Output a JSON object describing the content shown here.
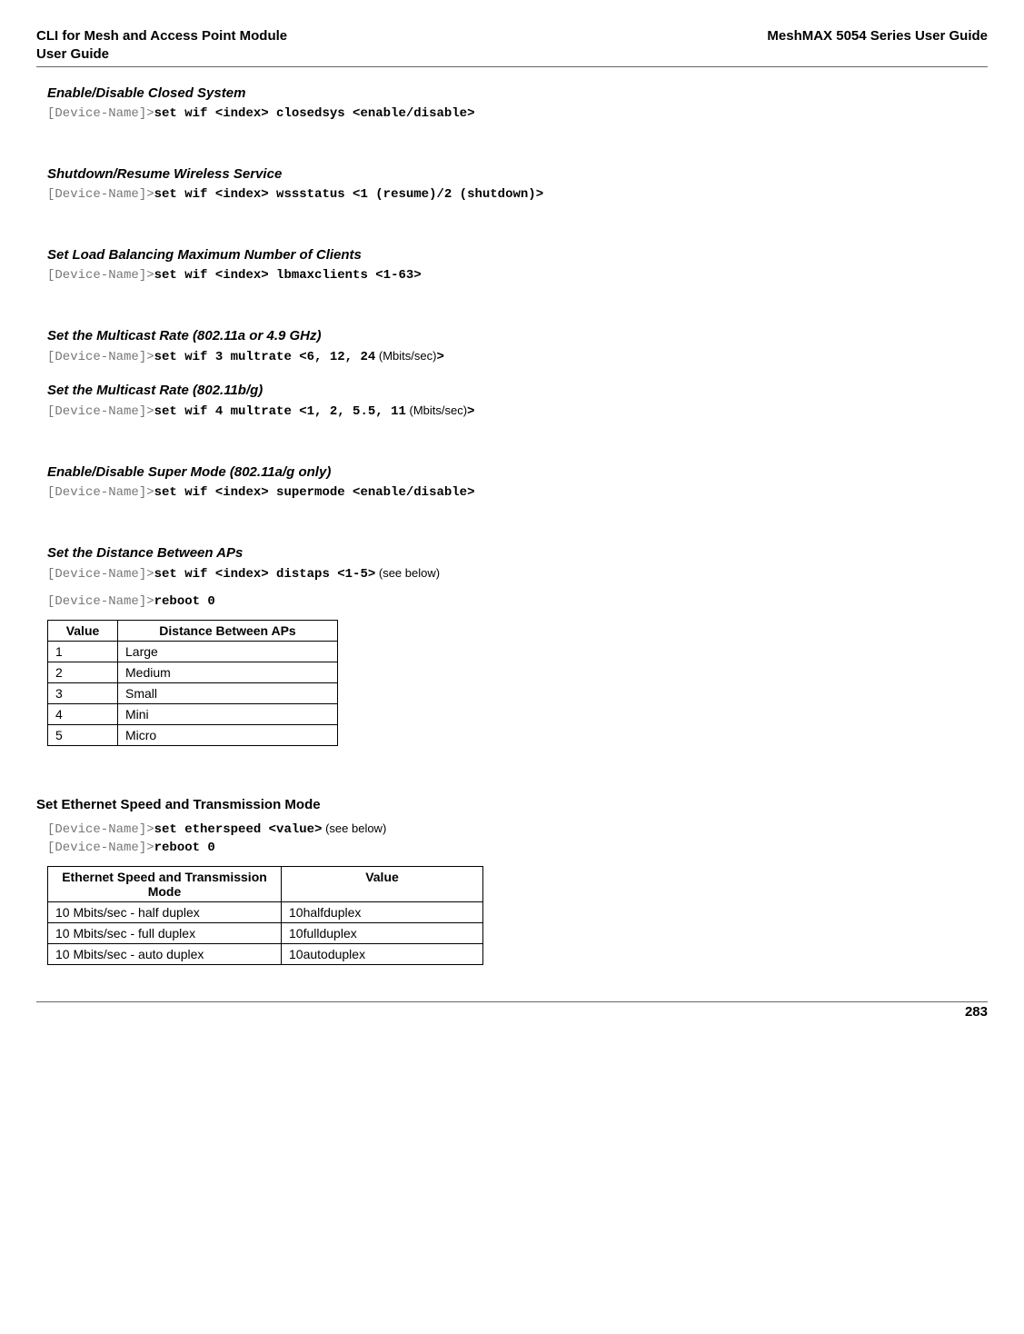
{
  "header": {
    "left_line1": "CLI for Mesh and Access Point Module",
    "left_line2": " User Guide",
    "right": "MeshMAX 5054 Series User Guide"
  },
  "sections": {
    "s1": {
      "title": "Enable/Disable Closed System",
      "prompt": "[Device-Name]>",
      "cmd": "set wif <index> closedsys <enable/disable>"
    },
    "s2": {
      "title": "Shutdown/Resume Wireless Service",
      "prompt": "[Device-Name]>",
      "cmd": "set wif <index> wssstatus <1 (resume)/2 (shutdown)>"
    },
    "s3": {
      "title": "Set Load Balancing Maximum Number of Clients",
      "prompt": "[Device-Name]>",
      "cmd": "set wif <index> lbmaxclients <1-63>"
    },
    "s4": {
      "title": "Set the Multicast Rate (802.11a or 4.9 GHz)",
      "prompt": "[Device-Name]>",
      "cmd_a": "set wif 3 multrate <6, 12, 24",
      "note_a": " (Mbits/sec)",
      "cmd_a_end": ">"
    },
    "s5": {
      "title": "Set the Multicast Rate (802.11b/g)",
      "prompt": "[Device-Name]>",
      "cmd_a": "set wif 4 multrate <1, 2, 5.5, 11",
      "note_a": " (Mbits/sec)",
      "cmd_a_end": ">"
    },
    "s6": {
      "title": "Enable/Disable Super Mode (802.11a/g only)",
      "prompt": "[Device-Name]>",
      "cmd": "set wif <index> supermode <enable/disable>"
    },
    "s7": {
      "title": "Set the Distance Between APs",
      "prompt": "[Device-Name]>",
      "cmd1": "set wif <index> distaps <1-5>",
      "note1": " (see below)",
      "cmd2": "reboot 0"
    },
    "table1": {
      "h1": "Value",
      "h2": "Distance Between APs",
      "rows": [
        {
          "v": "1",
          "d": "Large"
        },
        {
          "v": "2",
          "d": "Medium"
        },
        {
          "v": "3",
          "d": "Small"
        },
        {
          "v": "4",
          "d": "Mini"
        },
        {
          "v": "5",
          "d": "Micro"
        }
      ]
    },
    "s8": {
      "title": "Set Ethernet Speed and Transmission Mode",
      "prompt": "[Device-Name]>",
      "cmd1": "set etherspeed <value>",
      "note1": " (see below)",
      "cmd2": "reboot 0"
    },
    "table2": {
      "h1": "Ethernet Speed and Transmission Mode",
      "h2": "Value",
      "rows": [
        {
          "m": "10 Mbits/sec - half duplex",
          "v": "10halfduplex"
        },
        {
          "m": "10 Mbits/sec - full duplex",
          "v": "10fullduplex"
        },
        {
          "m": "10 Mbits/sec - auto duplex",
          "v": "10autoduplex"
        }
      ]
    }
  },
  "footer": {
    "page": "283"
  }
}
